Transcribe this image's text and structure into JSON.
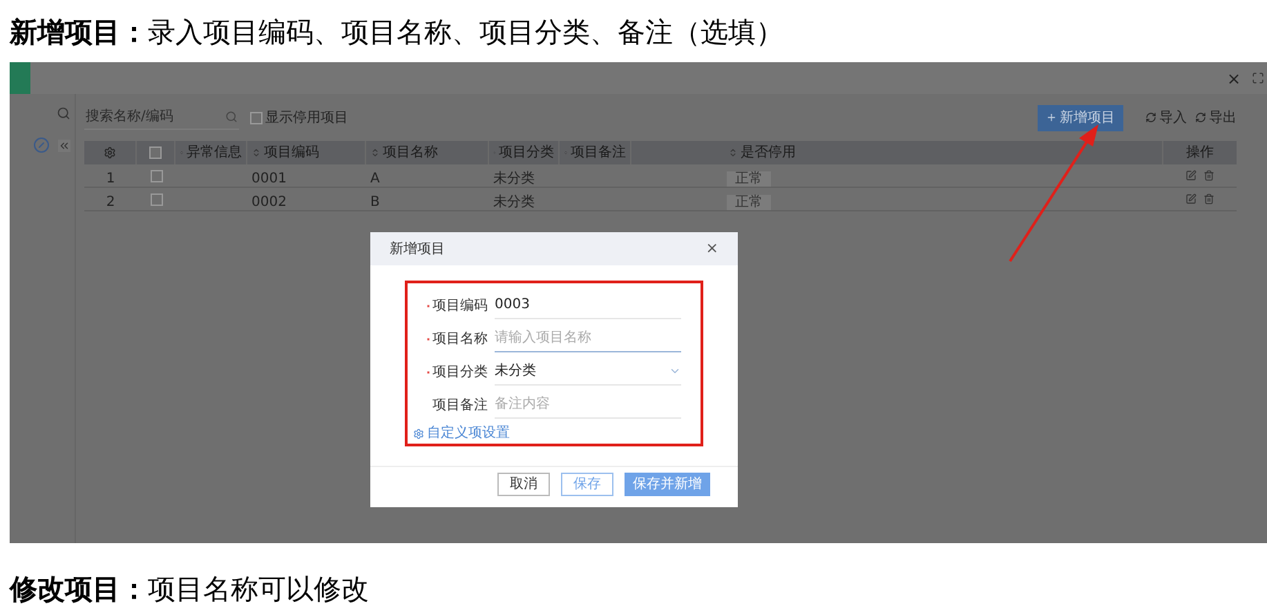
{
  "caption_top": {
    "title": "新增项目：",
    "text": "录入项目编码、项目名称、项目分类、备注（选填）"
  },
  "window": {
    "close": "×"
  },
  "toolbar": {
    "search": {
      "placeholder": "搜索名称/编码"
    },
    "show_disabled": {
      "label": "显示停用项目",
      "checked": false
    },
    "buttons": [
      {
        "label": "新增项目",
        "kind": "primary"
      },
      {
        "label": "导入",
        "kind": "link"
      },
      {
        "label": "导出",
        "kind": "link"
      }
    ]
  },
  "table": {
    "columns": [
      {
        "kind": "gear"
      },
      {
        "kind": "check",
        "checked": false
      },
      {
        "label": "异常信息",
        "kind": "text"
      },
      {
        "label": "项目编码",
        "kind": "text"
      },
      {
        "label": "项目名称",
        "kind": "text"
      },
      {
        "label": "项目分类",
        "kind": "text"
      },
      {
        "label": "项目备注",
        "kind": "text"
      },
      {
        "label": "是否停用",
        "kind": "text"
      },
      {
        "label": "操作",
        "kind": "plain"
      }
    ],
    "rows": [
      {
        "index": "1",
        "checked": false,
        "code": "0001",
        "name": "A",
        "category": "未分类",
        "status": "正常"
      },
      {
        "index": "2",
        "checked": false,
        "code": "0002",
        "name": "B",
        "category": "未分类",
        "status": "正常"
      }
    ]
  },
  "dialog": {
    "title": "新增项目",
    "close": "×",
    "fields": [
      {
        "label": "项目编码",
        "required": true,
        "kind": "text",
        "value": "0003"
      },
      {
        "label": "项目名称",
        "required": true,
        "kind": "text",
        "placeholder": "请输入项目名称"
      },
      {
        "label": "项目分类",
        "required": true,
        "kind": "select",
        "value": "未分类"
      },
      {
        "label": "项目备注",
        "required": false,
        "kind": "text",
        "placeholder": "备注内容"
      }
    ],
    "link": "自定义项设置",
    "buttons": [
      {
        "label": "取消",
        "kind": "default"
      },
      {
        "label": "保存",
        "kind": "outline"
      },
      {
        "label": "保存并新增",
        "kind": "primary"
      }
    ]
  },
  "caption_bottom": {
    "title": "修改项目：",
    "text": "项目名称可以修改"
  }
}
